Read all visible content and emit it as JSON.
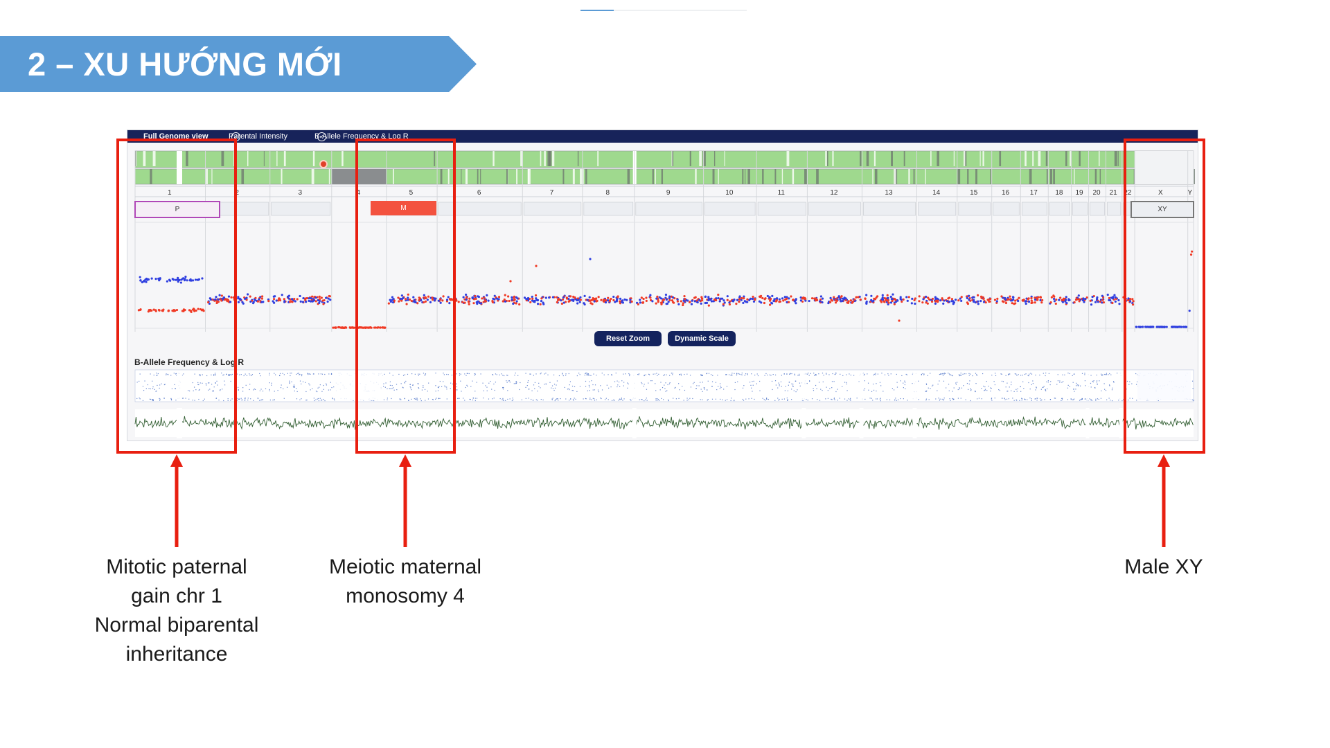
{
  "slide": {
    "title": "2 – XU HƯỚNG MỚI",
    "accent_color": "#5b9bd5",
    "highlight_color": "#e81f10"
  },
  "viewer": {
    "tabs": [
      "Full Genome view",
      "Parental Intensity",
      "B-Allele Frequency & Log R"
    ],
    "chromosomes": [
      "1",
      "2",
      "3",
      "4",
      "5",
      "6",
      "7",
      "8",
      "9",
      "10",
      "11",
      "12",
      "13",
      "14",
      "15",
      "16",
      "17",
      "18",
      "19",
      "20",
      "21",
      "22",
      "X",
      "Y"
    ],
    "parent_badges": {
      "chr1": "P",
      "chr4": "M",
      "sex": "XY"
    },
    "buttons": [
      "Reset Zoom",
      "Dynamic Scale"
    ],
    "baf_section_title": "B-Allele Frequency & Log R",
    "colors": {
      "header": "#17235a",
      "paternal": "#2f3fe0",
      "maternal": "#f03a25",
      "baf": "#3b64c2",
      "logr": "#1c4d1c",
      "track": "#9fd98e"
    }
  },
  "callouts": [
    {
      "name": "chr1",
      "text": "Mitotic paternal\ngain chr 1\nNormal biparental\ninheritance"
    },
    {
      "name": "chr4",
      "text": "Meiotic maternal\nmonosomy 4"
    },
    {
      "name": "xy",
      "text": "Male XY"
    }
  ]
}
